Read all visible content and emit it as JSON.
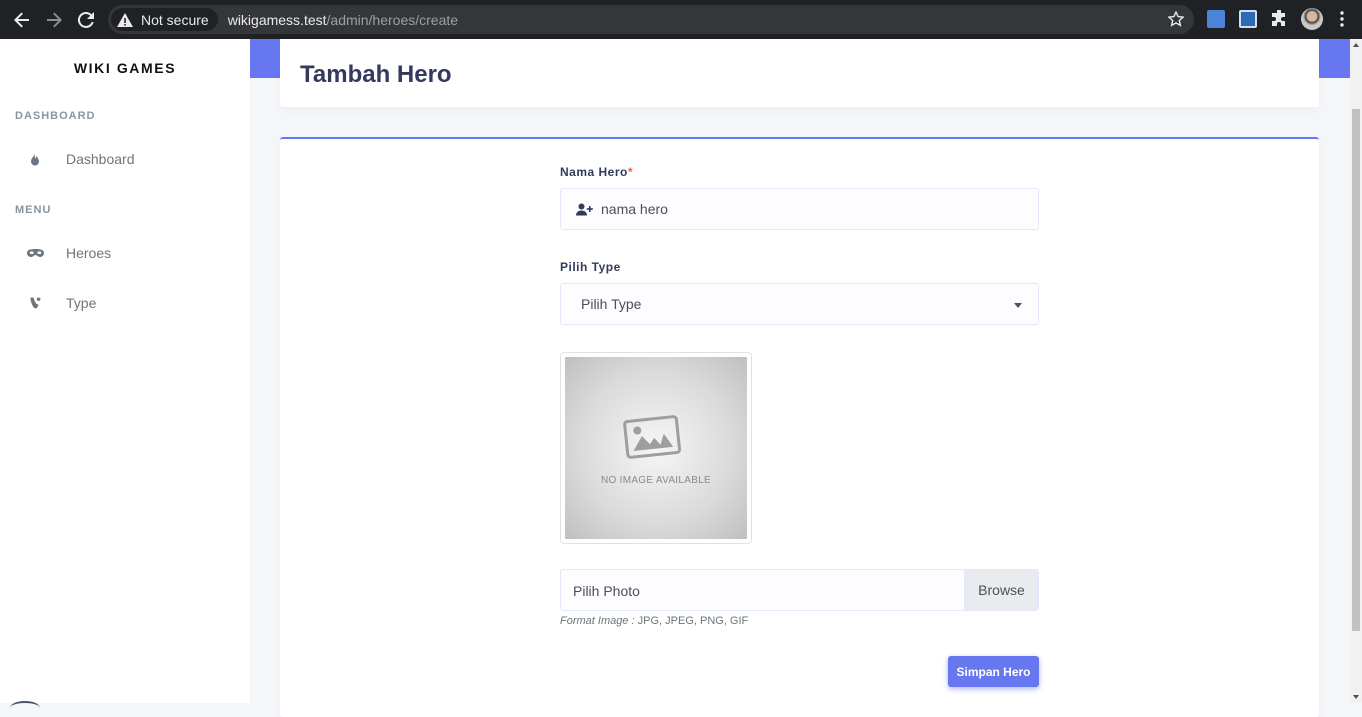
{
  "browser": {
    "security_label": "Not secure",
    "url_host": "wikigamess.test",
    "url_path": "/admin/heroes/create"
  },
  "sidebar": {
    "brand": "WIKI GAMES",
    "sections": [
      {
        "header": "DASHBOARD",
        "items": [
          {
            "label": "Dashboard",
            "icon": "fire-icon"
          }
        ]
      },
      {
        "header": "MENU",
        "items": [
          {
            "label": "Heroes",
            "icon": "mask-icon"
          },
          {
            "label": "Type",
            "icon": "typo3-icon"
          }
        ]
      }
    ]
  },
  "header": {
    "title": "Tambah Hero"
  },
  "form": {
    "name_label": "Nama Hero",
    "name_required_mark": "*",
    "name_placeholder": "nama hero",
    "type_label": "Pilih Type",
    "type_selected": "Pilih Type",
    "image_placeholder_text": "NO IMAGE AVAILABLE",
    "photo_label": "Pilih Photo",
    "browse_label": "Browse",
    "format_hint_prefix": "Format Image :",
    "format_hint_values": " JPG, JPEG, PNG, GIF",
    "submit_label": "Simpan Hero"
  },
  "colors": {
    "primary": "#6777ef",
    "title": "#34395e",
    "required": "#fc544b"
  }
}
